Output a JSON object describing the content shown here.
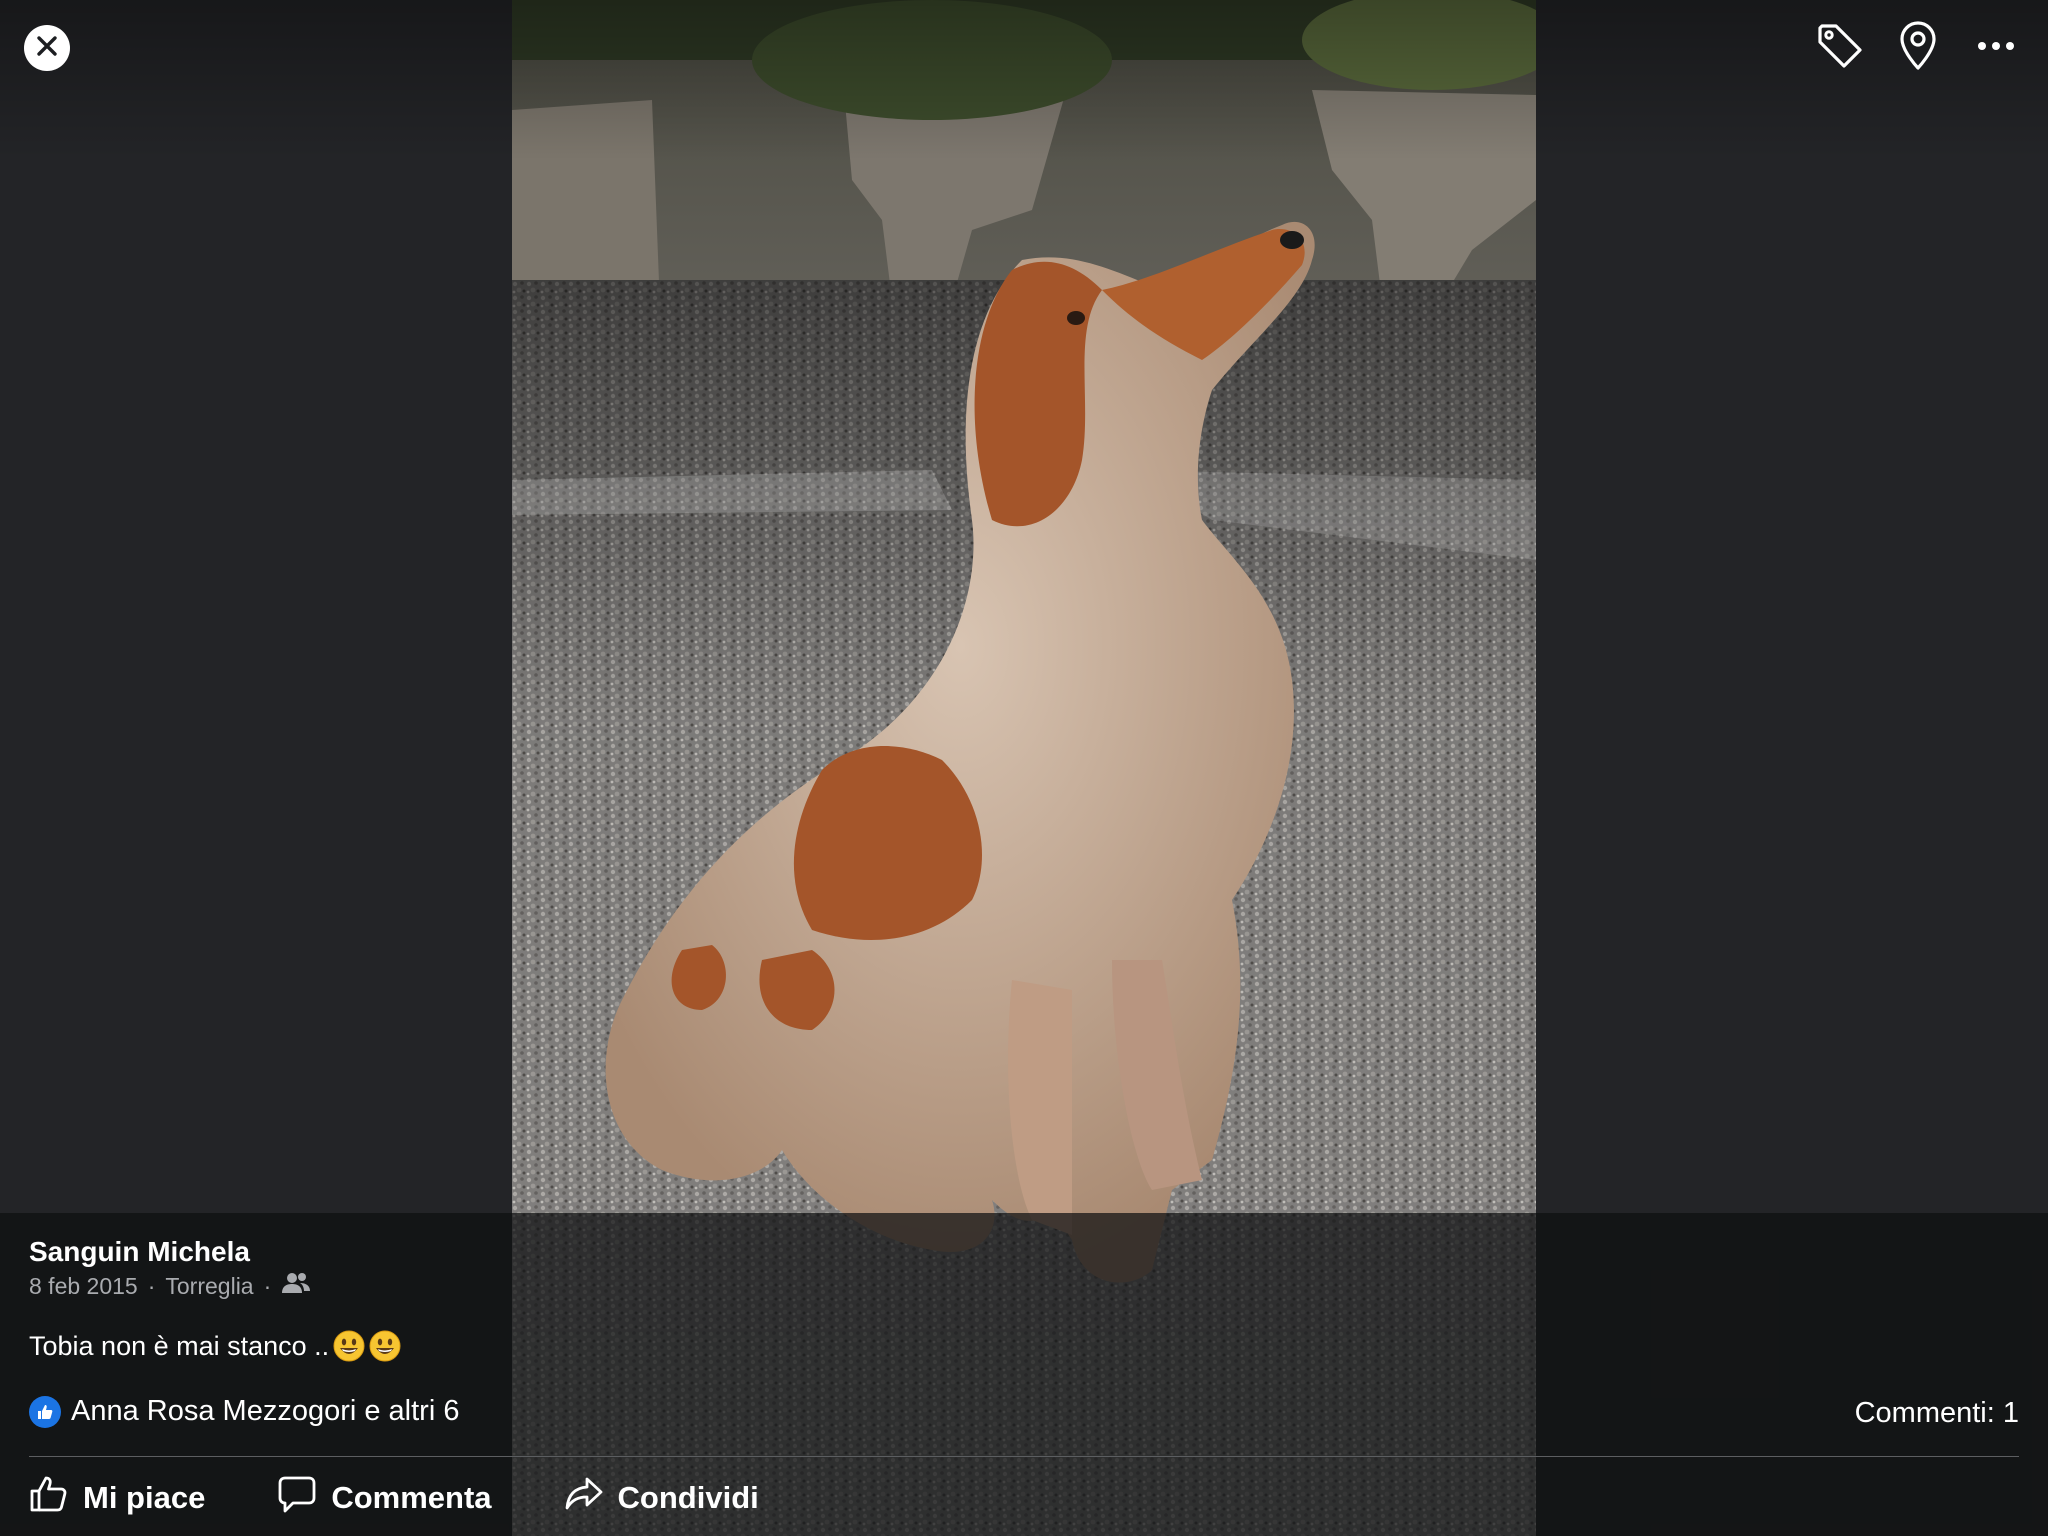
{
  "top": {
    "close_icon": "close-icon",
    "actions": [
      {
        "icon": "tag-icon"
      },
      {
        "icon": "location-pin-icon"
      },
      {
        "icon": "more-icon"
      }
    ]
  },
  "photo": {
    "subject": "dog"
  },
  "post": {
    "author": "Sanguin Michela",
    "date": "8 feb 2015",
    "location": "Torreglia",
    "audience_icon": "friends-icon",
    "caption": "Tobia non è mai stanco ..",
    "reactions_text": "Anna Rosa Mezzogori e altri 6",
    "comments_text": "Commenti: 1"
  },
  "actions": {
    "like": "Mi piace",
    "comment": "Commenta",
    "share": "Condividi"
  },
  "colors": {
    "background": "#232427",
    "like_blue": "#1b74e4",
    "meta_gray": "#a9abaf"
  }
}
